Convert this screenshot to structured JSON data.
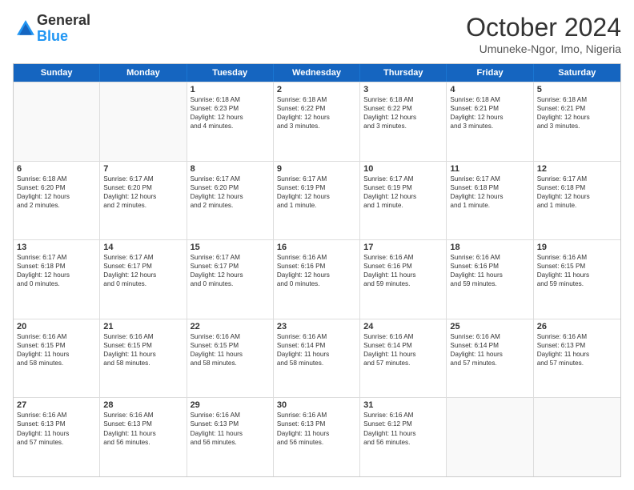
{
  "header": {
    "logo_general": "General",
    "logo_blue": "Blue",
    "month_title": "October 2024",
    "location": "Umuneke-Ngor, Imo, Nigeria"
  },
  "weekdays": [
    "Sunday",
    "Monday",
    "Tuesday",
    "Wednesday",
    "Thursday",
    "Friday",
    "Saturday"
  ],
  "rows": [
    [
      {
        "day": "",
        "empty": true
      },
      {
        "day": "",
        "empty": true
      },
      {
        "day": "1",
        "lines": [
          "Sunrise: 6:18 AM",
          "Sunset: 6:23 PM",
          "Daylight: 12 hours",
          "and 4 minutes."
        ]
      },
      {
        "day": "2",
        "lines": [
          "Sunrise: 6:18 AM",
          "Sunset: 6:22 PM",
          "Daylight: 12 hours",
          "and 3 minutes."
        ]
      },
      {
        "day": "3",
        "lines": [
          "Sunrise: 6:18 AM",
          "Sunset: 6:22 PM",
          "Daylight: 12 hours",
          "and 3 minutes."
        ]
      },
      {
        "day": "4",
        "lines": [
          "Sunrise: 6:18 AM",
          "Sunset: 6:21 PM",
          "Daylight: 12 hours",
          "and 3 minutes."
        ]
      },
      {
        "day": "5",
        "lines": [
          "Sunrise: 6:18 AM",
          "Sunset: 6:21 PM",
          "Daylight: 12 hours",
          "and 3 minutes."
        ]
      }
    ],
    [
      {
        "day": "6",
        "lines": [
          "Sunrise: 6:18 AM",
          "Sunset: 6:20 PM",
          "Daylight: 12 hours",
          "and 2 minutes."
        ]
      },
      {
        "day": "7",
        "lines": [
          "Sunrise: 6:17 AM",
          "Sunset: 6:20 PM",
          "Daylight: 12 hours",
          "and 2 minutes."
        ]
      },
      {
        "day": "8",
        "lines": [
          "Sunrise: 6:17 AM",
          "Sunset: 6:20 PM",
          "Daylight: 12 hours",
          "and 2 minutes."
        ]
      },
      {
        "day": "9",
        "lines": [
          "Sunrise: 6:17 AM",
          "Sunset: 6:19 PM",
          "Daylight: 12 hours",
          "and 1 minute."
        ]
      },
      {
        "day": "10",
        "lines": [
          "Sunrise: 6:17 AM",
          "Sunset: 6:19 PM",
          "Daylight: 12 hours",
          "and 1 minute."
        ]
      },
      {
        "day": "11",
        "lines": [
          "Sunrise: 6:17 AM",
          "Sunset: 6:18 PM",
          "Daylight: 12 hours",
          "and 1 minute."
        ]
      },
      {
        "day": "12",
        "lines": [
          "Sunrise: 6:17 AM",
          "Sunset: 6:18 PM",
          "Daylight: 12 hours",
          "and 1 minute."
        ]
      }
    ],
    [
      {
        "day": "13",
        "lines": [
          "Sunrise: 6:17 AM",
          "Sunset: 6:18 PM",
          "Daylight: 12 hours",
          "and 0 minutes."
        ]
      },
      {
        "day": "14",
        "lines": [
          "Sunrise: 6:17 AM",
          "Sunset: 6:17 PM",
          "Daylight: 12 hours",
          "and 0 minutes."
        ]
      },
      {
        "day": "15",
        "lines": [
          "Sunrise: 6:17 AM",
          "Sunset: 6:17 PM",
          "Daylight: 12 hours",
          "and 0 minutes."
        ]
      },
      {
        "day": "16",
        "lines": [
          "Sunrise: 6:16 AM",
          "Sunset: 6:16 PM",
          "Daylight: 12 hours",
          "and 0 minutes."
        ]
      },
      {
        "day": "17",
        "lines": [
          "Sunrise: 6:16 AM",
          "Sunset: 6:16 PM",
          "Daylight: 11 hours",
          "and 59 minutes."
        ]
      },
      {
        "day": "18",
        "lines": [
          "Sunrise: 6:16 AM",
          "Sunset: 6:16 PM",
          "Daylight: 11 hours",
          "and 59 minutes."
        ]
      },
      {
        "day": "19",
        "lines": [
          "Sunrise: 6:16 AM",
          "Sunset: 6:15 PM",
          "Daylight: 11 hours",
          "and 59 minutes."
        ]
      }
    ],
    [
      {
        "day": "20",
        "lines": [
          "Sunrise: 6:16 AM",
          "Sunset: 6:15 PM",
          "Daylight: 11 hours",
          "and 58 minutes."
        ]
      },
      {
        "day": "21",
        "lines": [
          "Sunrise: 6:16 AM",
          "Sunset: 6:15 PM",
          "Daylight: 11 hours",
          "and 58 minutes."
        ]
      },
      {
        "day": "22",
        "lines": [
          "Sunrise: 6:16 AM",
          "Sunset: 6:15 PM",
          "Daylight: 11 hours",
          "and 58 minutes."
        ]
      },
      {
        "day": "23",
        "lines": [
          "Sunrise: 6:16 AM",
          "Sunset: 6:14 PM",
          "Daylight: 11 hours",
          "and 58 minutes."
        ]
      },
      {
        "day": "24",
        "lines": [
          "Sunrise: 6:16 AM",
          "Sunset: 6:14 PM",
          "Daylight: 11 hours",
          "and 57 minutes."
        ]
      },
      {
        "day": "25",
        "lines": [
          "Sunrise: 6:16 AM",
          "Sunset: 6:14 PM",
          "Daylight: 11 hours",
          "and 57 minutes."
        ]
      },
      {
        "day": "26",
        "lines": [
          "Sunrise: 6:16 AM",
          "Sunset: 6:13 PM",
          "Daylight: 11 hours",
          "and 57 minutes."
        ]
      }
    ],
    [
      {
        "day": "27",
        "lines": [
          "Sunrise: 6:16 AM",
          "Sunset: 6:13 PM",
          "Daylight: 11 hours",
          "and 57 minutes."
        ]
      },
      {
        "day": "28",
        "lines": [
          "Sunrise: 6:16 AM",
          "Sunset: 6:13 PM",
          "Daylight: 11 hours",
          "and 56 minutes."
        ]
      },
      {
        "day": "29",
        "lines": [
          "Sunrise: 6:16 AM",
          "Sunset: 6:13 PM",
          "Daylight: 11 hours",
          "and 56 minutes."
        ]
      },
      {
        "day": "30",
        "lines": [
          "Sunrise: 6:16 AM",
          "Sunset: 6:13 PM",
          "Daylight: 11 hours",
          "and 56 minutes."
        ]
      },
      {
        "day": "31",
        "lines": [
          "Sunrise: 6:16 AM",
          "Sunset: 6:12 PM",
          "Daylight: 11 hours",
          "and 56 minutes."
        ]
      },
      {
        "day": "",
        "empty": true
      },
      {
        "day": "",
        "empty": true
      }
    ]
  ]
}
